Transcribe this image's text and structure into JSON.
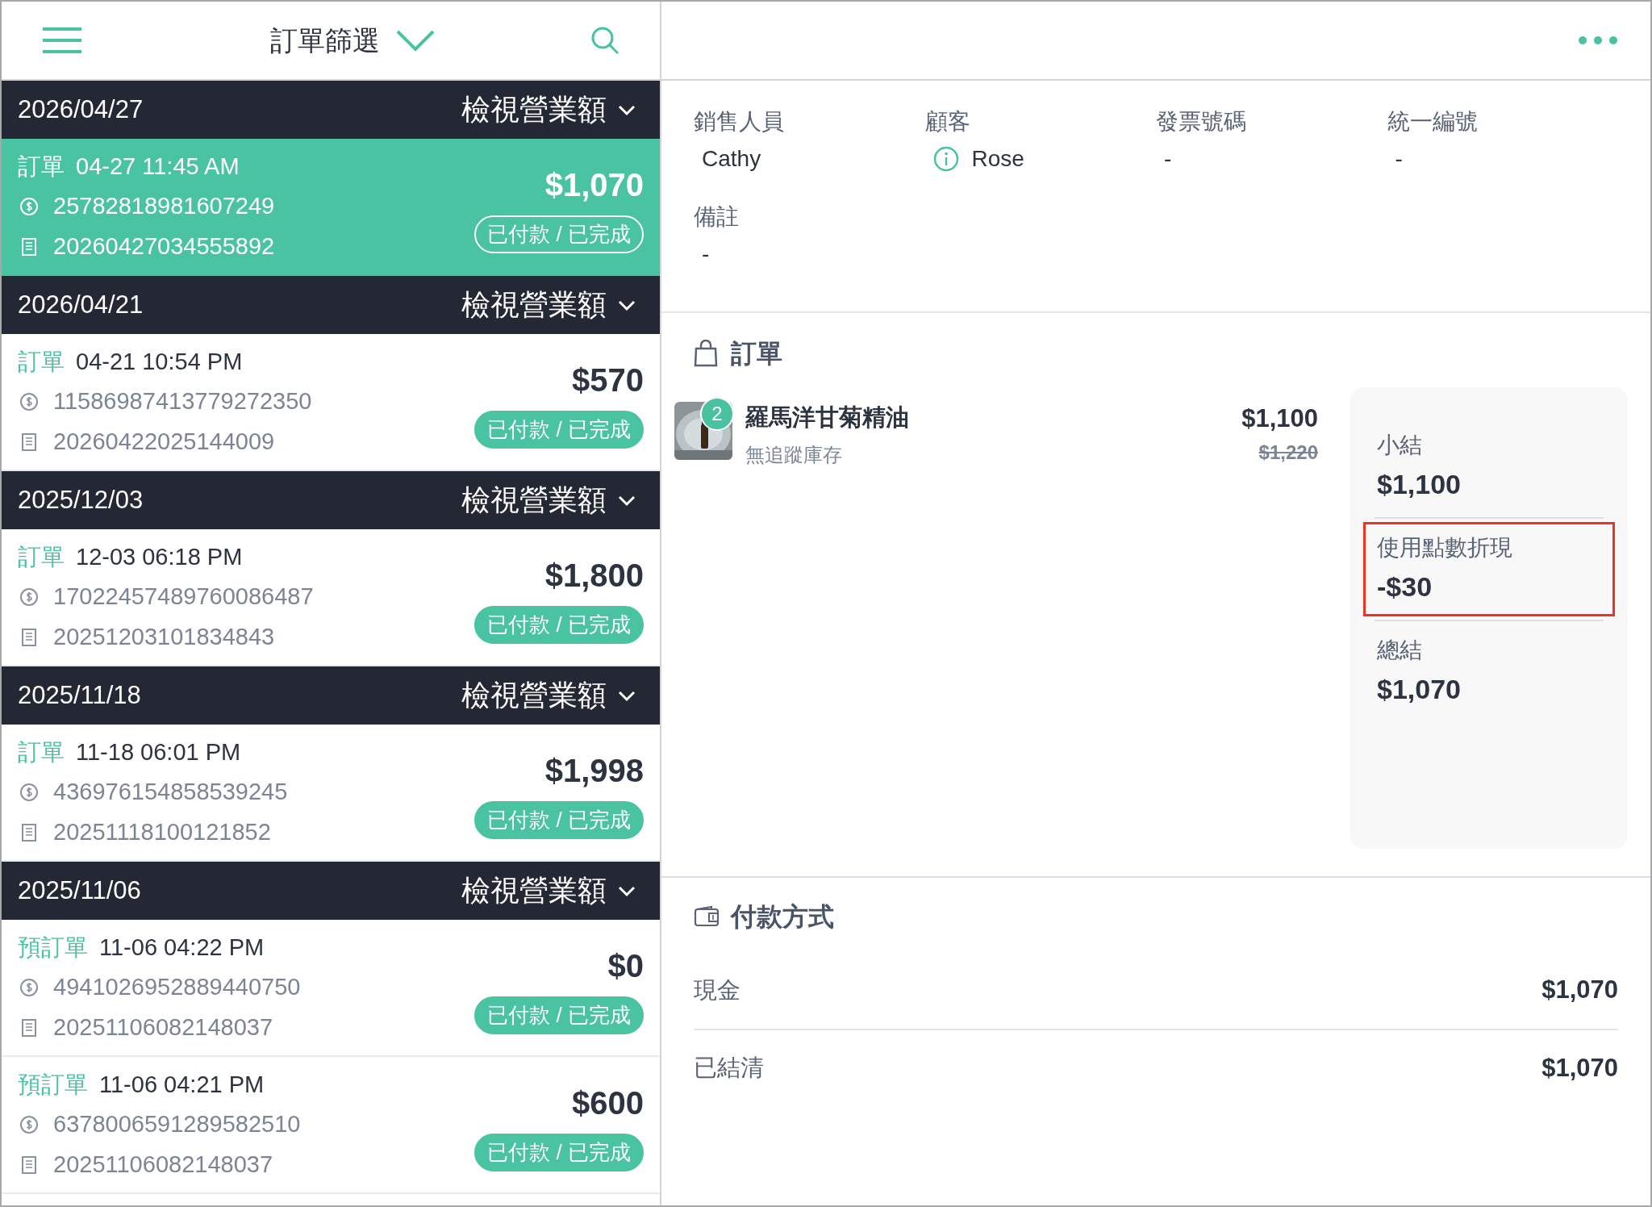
{
  "header": {
    "title": "訂單篩選"
  },
  "groups": [
    {
      "date": "2026/04/27",
      "action": "檢視營業額",
      "orders": [
        {
          "type": "訂單",
          "time": "04-27 11:45 AM",
          "payment_no": "25782818981607249",
          "invoice_no": "20260427034555892",
          "amount": "$1,070",
          "status": "已付款 / 已完成",
          "selected": true
        }
      ]
    },
    {
      "date": "2026/04/21",
      "action": "檢視營業額",
      "orders": [
        {
          "type": "訂單",
          "time": "04-21 10:54 PM",
          "payment_no": "11586987413779272350",
          "invoice_no": "20260422025144009",
          "amount": "$570",
          "status": "已付款 / 已完成",
          "selected": false
        }
      ]
    },
    {
      "date": "2025/12/03",
      "action": "檢視營業額",
      "orders": [
        {
          "type": "訂單",
          "time": "12-03 06:18 PM",
          "payment_no": "17022457489760086487",
          "invoice_no": "20251203101834843",
          "amount": "$1,800",
          "status": "已付款 / 已完成",
          "selected": false
        }
      ]
    },
    {
      "date": "2025/11/18",
      "action": "檢視營業額",
      "orders": [
        {
          "type": "訂單",
          "time": "11-18 06:01 PM",
          "payment_no": "436976154858539245",
          "invoice_no": "20251118100121852",
          "amount": "$1,998",
          "status": "已付款 / 已完成",
          "selected": false
        }
      ]
    },
    {
      "date": "2025/11/06",
      "action": "檢視營業額",
      "orders": [
        {
          "type": "預訂單",
          "time": "11-06 04:22 PM",
          "payment_no": "4941026952889440750",
          "invoice_no": "20251106082148037",
          "amount": "$0",
          "status": "已付款 / 已完成",
          "selected": false
        },
        {
          "type": "預訂單",
          "time": "11-06 04:21 PM",
          "payment_no": "6378006591289582510",
          "invoice_no": "20251106082148037",
          "amount": "$600",
          "status": "已付款 / 已完成",
          "selected": false
        }
      ]
    }
  ],
  "details": [
    {
      "label": "銷售人員",
      "value": "Cathy",
      "kind": "text"
    },
    {
      "label": "顧客",
      "value": "Rose",
      "kind": "customer"
    },
    {
      "label": "發票號碼",
      "value": "-",
      "kind": "text"
    },
    {
      "label": "統一編號",
      "value": "-",
      "kind": "text"
    },
    {
      "label": "備註",
      "value": "-",
      "kind": "text"
    }
  ],
  "order_section": {
    "title": "訂單",
    "items": [
      {
        "kind": "picture",
        "quantity": "2",
        "name": "羅馬洋甘菊精油",
        "stock": "無追蹤庫存",
        "price": "$1,100",
        "original_price": "$1,220"
      }
    ],
    "summary": [
      {
        "label": "小結",
        "value": "$1,100",
        "highlighted": false
      },
      {
        "label": "使用點數折現",
        "value": "-$30",
        "highlighted": true
      },
      {
        "label": "總結",
        "value": "$1,070",
        "highlighted": false
      }
    ]
  },
  "payment": {
    "title": "付款方式",
    "rows": [
      {
        "label": "現金",
        "value": "$1,070"
      },
      {
        "label": "已結清",
        "value": "$1,070"
      }
    ]
  }
}
